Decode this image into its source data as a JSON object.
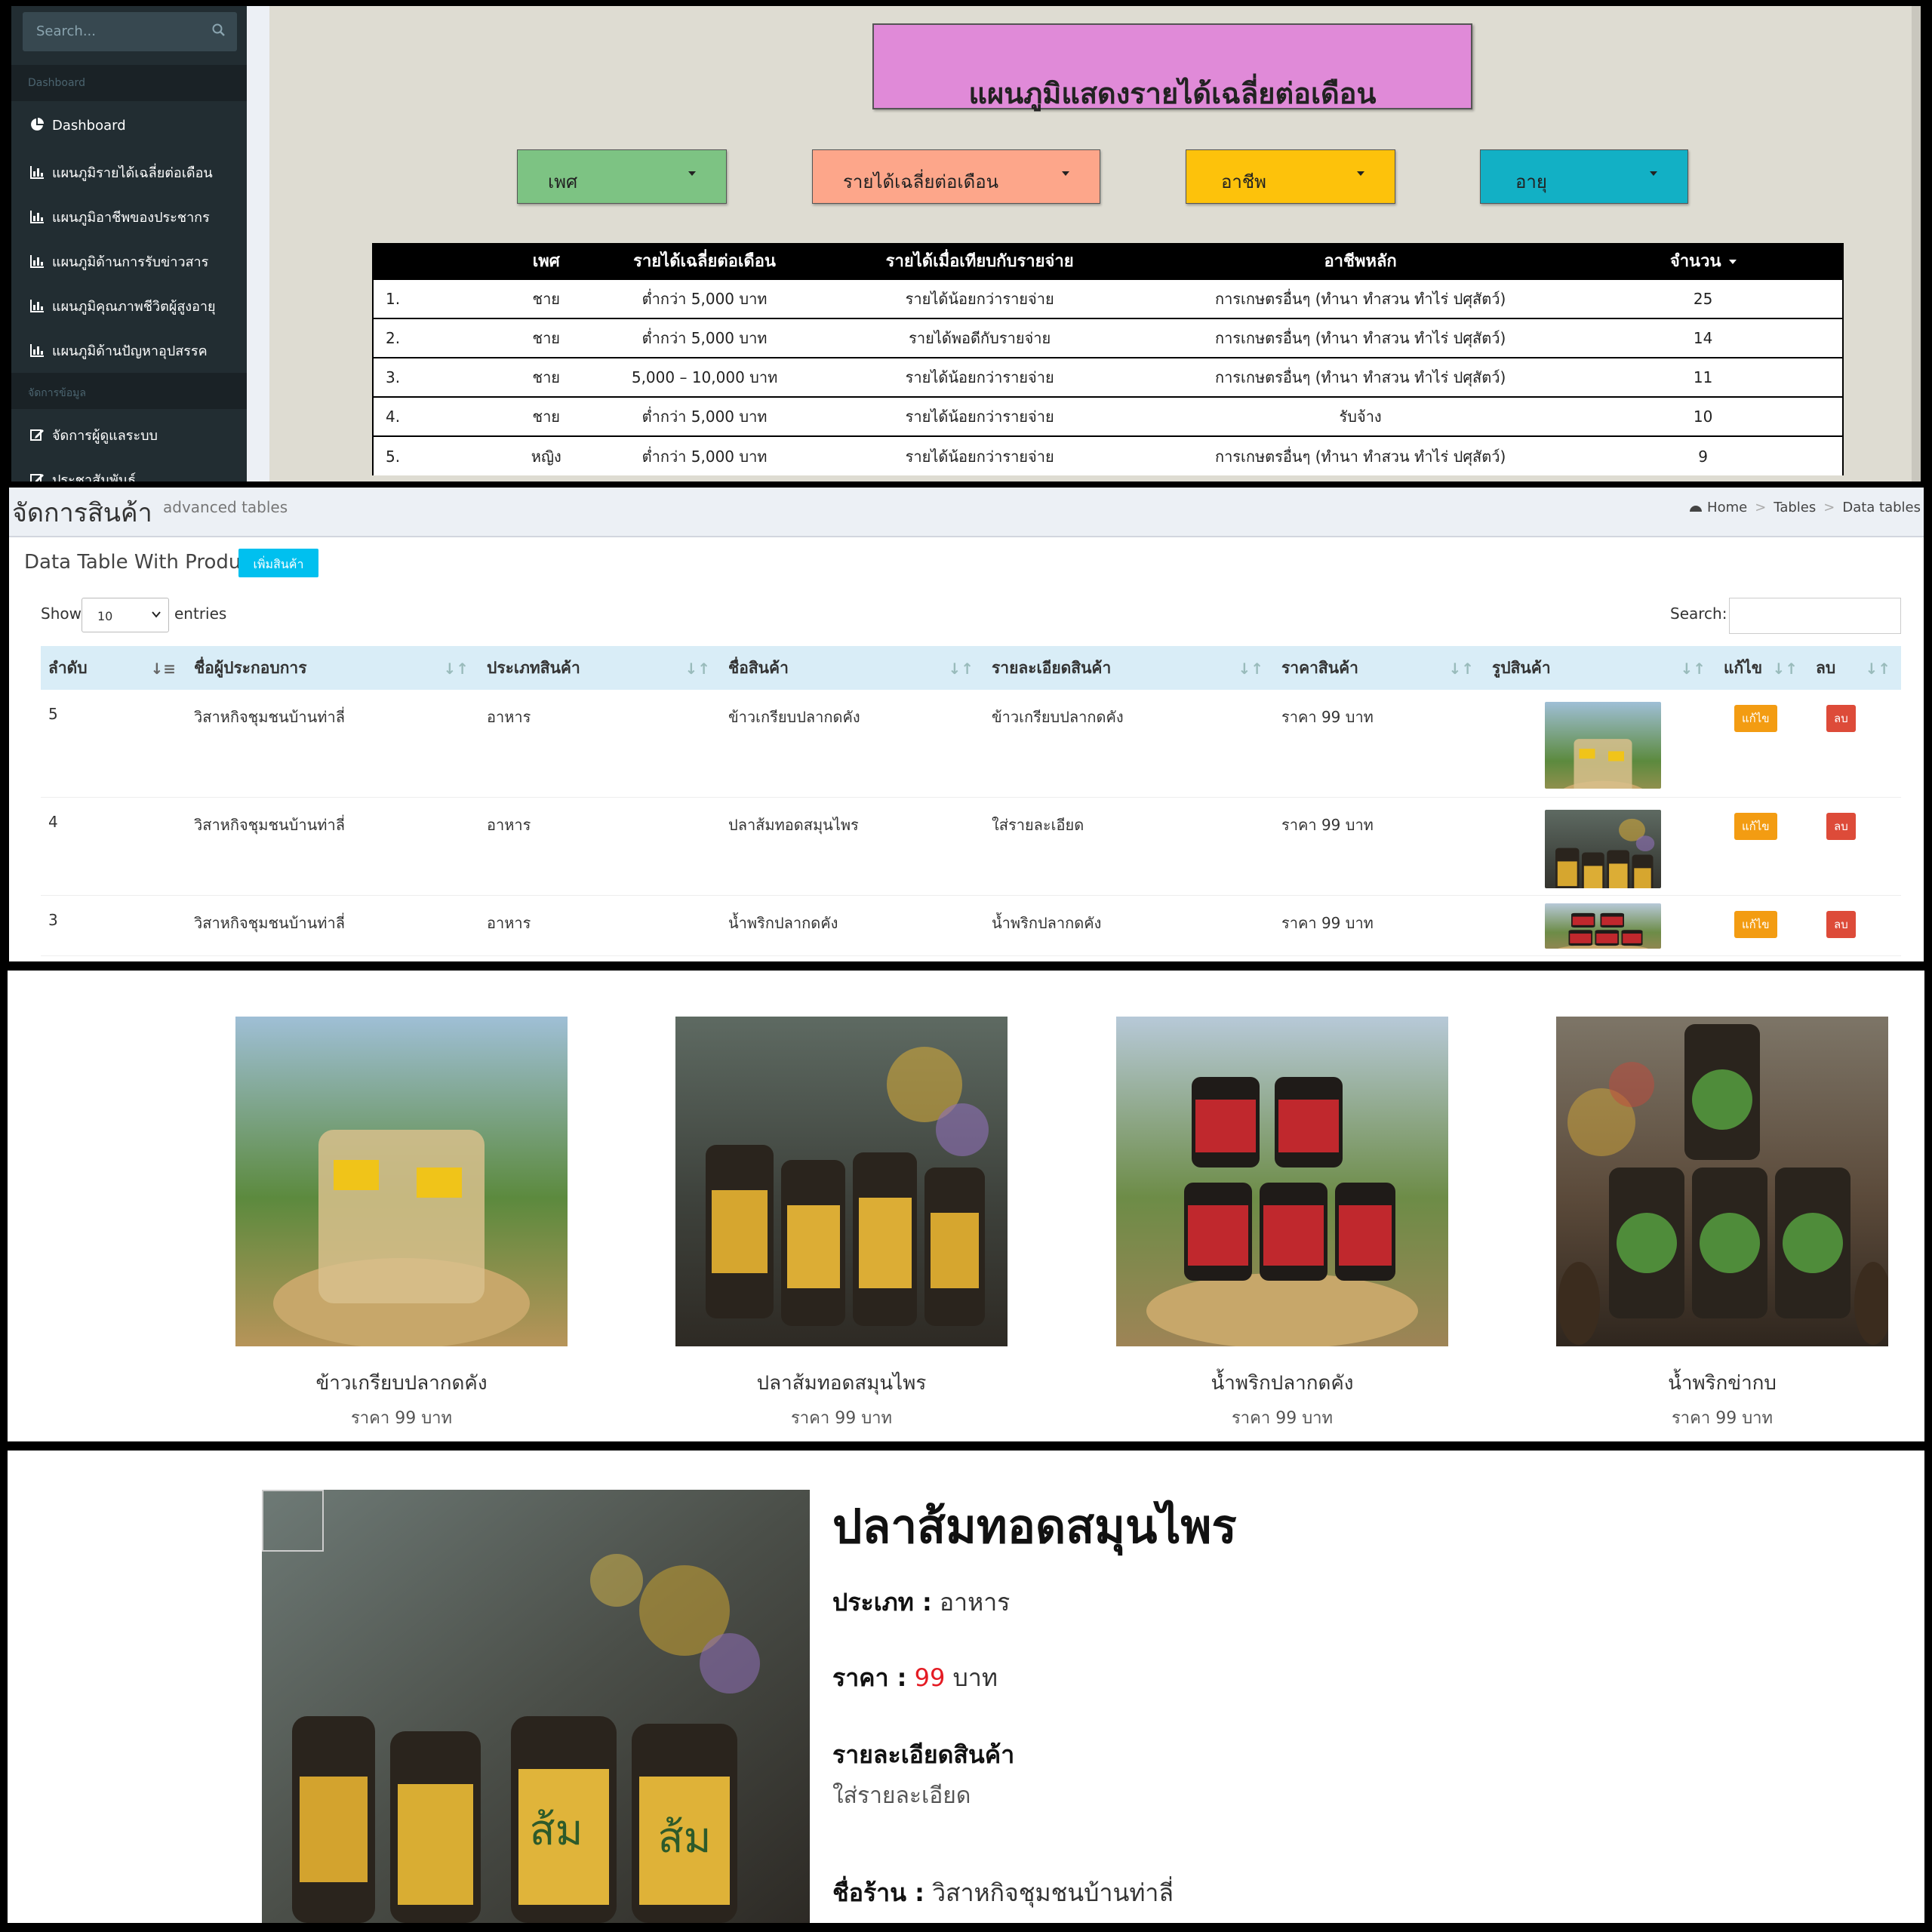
{
  "dashboard": {
    "sidebar": {
      "search_placeholder": "Search...",
      "section1": "Dashboard",
      "items": [
        {
          "label": "Dashboard",
          "icon": "pie-chart-icon"
        },
        {
          "label": "แผนภูมิรายได้เฉลี่ยต่อเดือน",
          "icon": "bar-chart-icon"
        },
        {
          "label": "แผนภูมิอาชีพของประชากร",
          "icon": "bar-chart-icon"
        },
        {
          "label": "แผนภูมิด้านการรับข่าวสาร",
          "icon": "bar-chart-icon"
        },
        {
          "label": "แผนภูมิคุณภาพชีวิตผู้สูงอายุ",
          "icon": "bar-chart-icon"
        },
        {
          "label": "แผนภูมิด้านปัญหาอุปสรรค",
          "icon": "bar-chart-icon"
        }
      ],
      "section2": "จัดการข้อมูล",
      "items2": [
        {
          "label": "จัดการผู้ดูแลระบบ",
          "icon": "edit-icon"
        },
        {
          "label": "ประชาสัมพันธ์",
          "icon": "edit-icon"
        }
      ]
    },
    "title": "แผนภูมิแสดงรายได้เฉลี่ยต่อเดือน",
    "filters": [
      {
        "label": "เพศ",
        "color": "#7dc383"
      },
      {
        "label": "รายได้เฉลี่ยต่อเดือน",
        "color": "#fda68a"
      },
      {
        "label": "อาชีพ",
        "color": "#fdc20b"
      },
      {
        "label": "อายุ",
        "color": "#12b0c5"
      }
    ],
    "table": {
      "headers": [
        "",
        "เพศ",
        "รายได้เฉลี่ยต่อเดือน",
        "รายได้เมื่อเทียบกับรายจ่าย",
        "อาชีพหลัก",
        "จำนวน"
      ],
      "rows": [
        [
          "1.",
          "ชาย",
          "ต่ำกว่า 5,000 บาท",
          "รายได้น้อยกว่ารายจ่าย",
          "การเกษตรอื่นๆ (ทำนา ทำสวน ทำไร่ ปศุสัตว์)",
          "25"
        ],
        [
          "2.",
          "ชาย",
          "ต่ำกว่า 5,000 บาท",
          "รายได้พอดีกับรายจ่าย",
          "การเกษตรอื่นๆ (ทำนา ทำสวน ทำไร่ ปศุสัตว์)",
          "14"
        ],
        [
          "3.",
          "ชาย",
          "5,000 – 10,000 บาท",
          "รายได้น้อยกว่ารายจ่าย",
          "การเกษตรอื่นๆ (ทำนา ทำสวน ทำไร่ ปศุสัตว์)",
          "11"
        ],
        [
          "4.",
          "ชาย",
          "ต่ำกว่า 5,000 บาท",
          "รายได้น้อยกว่ารายจ่าย",
          "รับจ้าง",
          "10"
        ],
        [
          "5.",
          "หญิง",
          "ต่ำกว่า 5,000 บาท",
          "รายได้น้อยกว่ารายจ่าย",
          "การเกษตรอื่นๆ (ทำนา ทำสวน ทำไร่ ปศุสัตว์)",
          "9"
        ]
      ]
    }
  },
  "products_admin": {
    "page_title": "จัดการสินค้า",
    "page_subtitle": "advanced tables",
    "breadcrumb": [
      "Home",
      "Tables",
      "Data tables"
    ],
    "box_title": "Data Table With Product",
    "add_button": "เพิ่มสินค้า",
    "show_label": "Show",
    "length_value": "10",
    "entries_label": "entries",
    "search_label": "Search:",
    "headers": [
      "ลำดับ",
      "ชื่อผู้ประกอบการ",
      "ประเภทสินค้า",
      "ชื่อสินค้า",
      "รายละเอียดสินค้า",
      "ราคาสินค้า",
      "รูปสินค้า",
      "แก้ไข",
      "ลบ"
    ],
    "rows": [
      {
        "id": "5",
        "vendor": "วิสาหกิจชุมชนบ้านท่าลี่",
        "type": "อาหาร",
        "name": "ข้าวเกรียบปลากดคัง",
        "detail": "ข้าวเกรียบปลากดคัง",
        "price": "ราคา 99 บาท"
      },
      {
        "id": "4",
        "vendor": "วิสาหกิจชุมชนบ้านท่าลี่",
        "type": "อาหาร",
        "name": "ปลาส้มทอดสมุนไพร",
        "detail": "ใส่รายละเอียด",
        "price": "ราคา 99 บาท"
      },
      {
        "id": "3",
        "vendor": "วิสาหกิจชุมชนบ้านท่าลี่",
        "type": "อาหาร",
        "name": "น้ำพริกปลากดคัง",
        "detail": "น้ำพริกปลากดคัง",
        "price": "ราคา 99 บาท"
      }
    ],
    "edit_label": "แก้ไข",
    "delete_label": "ลบ"
  },
  "catalog": [
    {
      "name": "ข้าวเกรียบปลากดคัง",
      "price": "ราคา 99 บาท"
    },
    {
      "name": "ปลาส้มทอดสมุนไพร",
      "price": "ราคา 99 บาท"
    },
    {
      "name": "น้ำพริกปลากดคัง",
      "price": "ราคา 99 บาท"
    },
    {
      "name": "น้ำพริกข่ากบ",
      "price": "ราคา 99 บาท"
    }
  ],
  "detail": {
    "title": "ปลาส้มทอดสมุนไพร",
    "type_label": "ประเภท :",
    "type_value": "อาหาร",
    "price_label": "ราคา :",
    "price_value": "99",
    "price_unit": "บาท",
    "desc_label": "รายละเอียดสินค้า",
    "desc_value": "ใส่รายละเอียด",
    "shop_label": "ชื่อร้าน :",
    "shop_value": "วิสาหกิจชุมชนบ้านท่าลี่"
  }
}
